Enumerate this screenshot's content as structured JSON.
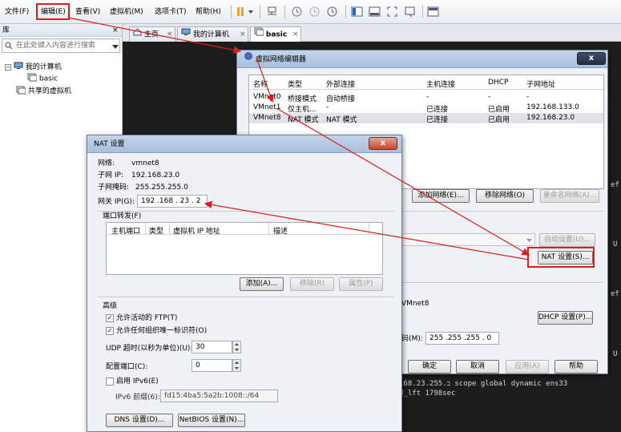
{
  "menubar": {
    "items": [
      "文件(F)",
      "编辑(E)",
      "查看(V)",
      "虚拟机(M)",
      "选项卡(T)",
      "帮助(H)"
    ]
  },
  "library": {
    "title": "库",
    "close": "×",
    "search_placeholder": "在此处键入内容进行搜索",
    "tree": {
      "my_computer": "我的计算机",
      "basic": "basic",
      "shared": "共享的虚拟机"
    }
  },
  "tabs": [
    {
      "label": "主页"
    },
    {
      "label": "我的计算机"
    },
    {
      "label": "basic"
    }
  ],
  "tab_close": "×",
  "console": {
    "right_fragments": [
      "ef",
      "U",
      "ef",
      "U"
    ],
    "lines": [
      "ב.168.23.255 scope global dynamic ens33",
      "d_lft 1798sec"
    ]
  },
  "vne": {
    "title": "虚拟网络编辑器",
    "close": "x",
    "columns": [
      "名称",
      "类型",
      "外部连接",
      "主机连接",
      "DHCP",
      "子网地址"
    ],
    "rows": [
      [
        "VMnet0",
        "桥接模式",
        "自动桥接",
        "-",
        "-",
        "-"
      ],
      [
        "VMnet1",
        "仅主机...",
        "-",
        "已连接",
        "已启用",
        "192.168.133.0"
      ],
      [
        "VMnet8",
        "NAT 模式",
        "NAT 模式",
        "已连接",
        "已启用",
        "192.168.23.0"
      ]
    ],
    "add_network": "添加网络(E)...",
    "remove_network": "移除网络(O)",
    "rename_network": "重命名网络(A)...",
    "auto_settings": "自动设置(U)...",
    "nat_settings": "NAT 设置(S)...",
    "vmnet_label": "VMnet8",
    "dhcp_settings": "DHCP 设置(P)...",
    "mask_label": "码(M):",
    "mask_value": "255 .255 .255 . 0",
    "ok": "确定",
    "cancel": "取消",
    "apply": "应用(A)",
    "help": "帮助"
  },
  "nat": {
    "title": "NAT 设置",
    "close": "x",
    "network_label": "网络:",
    "network_value": "vmnet8",
    "subnet_ip_label": "子网 IP:",
    "subnet_ip_value": "192.168.23.0",
    "subnet_mask_label": "子网掩码:",
    "subnet_mask_value": "255.255.255.0",
    "gateway_label": "网关 IP(G):",
    "gateway_value": "192 .168 . 23 . 2",
    "port_forward_label": "端口转发(F)",
    "pf_columns": [
      "主机端口",
      "类型",
      "虚拟机 IP 地址",
      "描述"
    ],
    "add": "添加(A)...",
    "remove": "移除(R)",
    "properties": "属性(P)",
    "advanced_label": "高级",
    "allow_ftp": "允许活动的 FTP(T)",
    "allow_ftp_checked": true,
    "allow_oui": "允许任何组织唯一标识符(O)",
    "allow_oui_checked": true,
    "udp_label": "UDP 超时(以秒为单位)(U):",
    "udp_value": "30",
    "config_port_label": "配置端口(C):",
    "config_port_value": "0",
    "ipv6_label": "启用 IPv6(E)",
    "ipv6_checked": false,
    "ipv6_prefix_label": "IPv6 前缀(6):",
    "ipv6_prefix_value": "fd15:4ba5:5a2b:1008::/64",
    "dns_settings": "DNS 设置(D)...",
    "netbios_settings": "NetBIOS 设置(N)..."
  },
  "colors": {
    "annotation": "#e01b1b",
    "selected_row": "#dfe3e8",
    "title_gradient": "#b9cde6"
  }
}
